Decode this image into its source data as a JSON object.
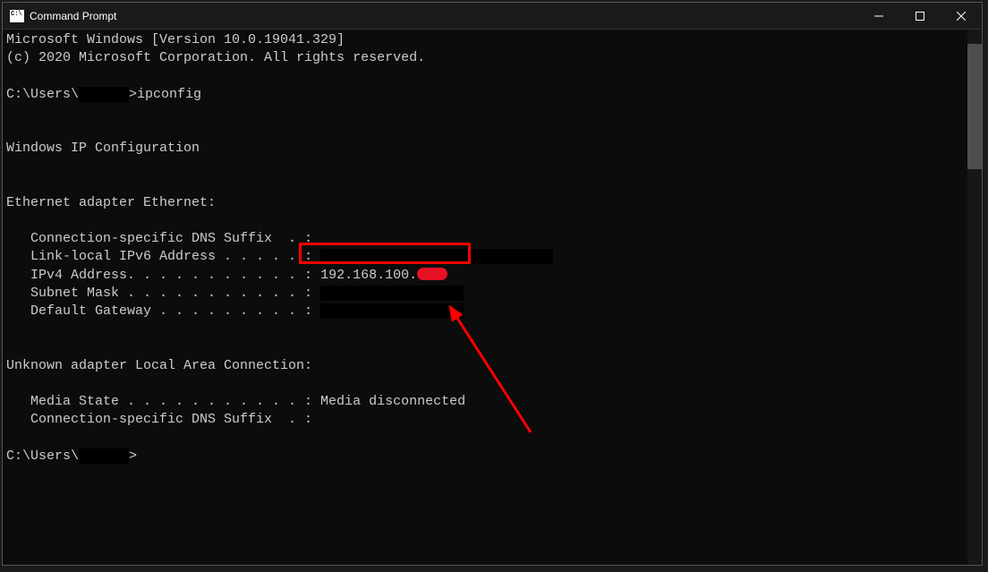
{
  "window": {
    "title": "Command Prompt"
  },
  "terminal": {
    "line1": "Microsoft Windows [Version 10.0.19041.329]",
    "line2": "(c) 2020 Microsoft Corporation. All rights reserved.",
    "prompt_prefix": "C:\\Users\\",
    "prompt_suffix": ">",
    "command": "ipconfig",
    "section_title": "Windows IP Configuration",
    "adapter1_title": "Ethernet adapter Ethernet:",
    "dns_suffix": "   Connection-specific DNS Suffix  . :",
    "ipv6_label": "   Link-local IPv6 Address . . . . . :",
    "ipv4_label": "   IPv4 Address. . . . . . . . . . . : ",
    "ipv4_value_partial": "192.168.100.",
    "subnet_label": "   Subnet Mask . . . . . . . . . . . :",
    "gateway_label": "   Default Gateway . . . . . . . . . :",
    "adapter2_title": "Unknown adapter Local Area Connection:",
    "media_state": "   Media State . . . . . . . . . . . : Media disconnected",
    "dns_suffix2": "   Connection-specific DNS Suffix  . :"
  }
}
